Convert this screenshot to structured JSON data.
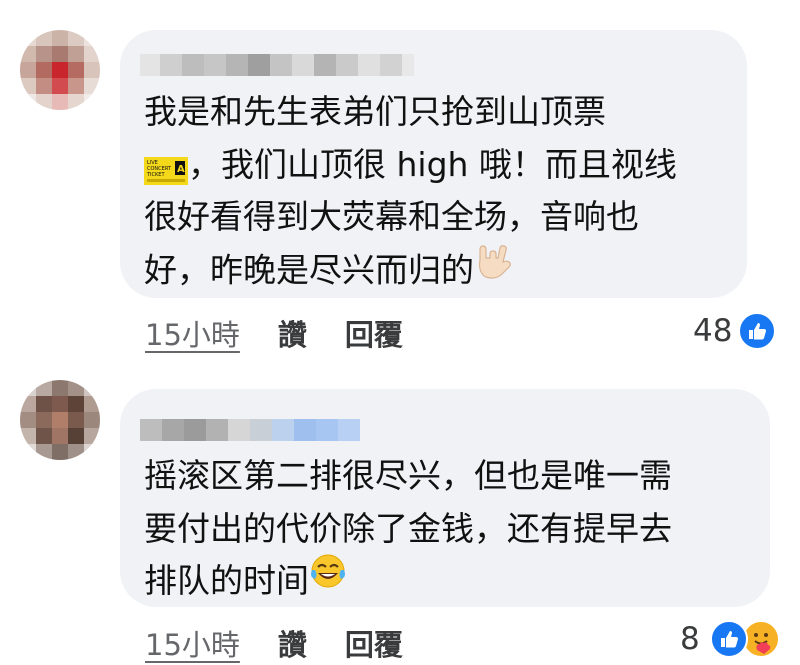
{
  "comments": [
    {
      "lines": [
        {
          "text": "我是和先生表弟们只抢到山顶票"
        },
        {
          "text": "，我们山顶很 high 哦！而且视线",
          "prefix_icon": "ticket-icon"
        },
        {
          "text": "很好看得到大荧幕和全场，音响也"
        },
        {
          "text": "好，昨晚是尽兴而归的",
          "suffix_icon": "love-you-gesture-emoji-icon"
        }
      ],
      "ticket_icon_text": [
        "LIVE",
        "CONCERT",
        "TICKET",
        "A"
      ],
      "time": "15小時",
      "like_label": "讚",
      "reply_label": "回覆",
      "reaction_count": "48",
      "reactions": [
        "like-reaction-icon"
      ]
    },
    {
      "lines": [
        {
          "text": "摇滚区第二排很尽兴，但也是唯一需"
        },
        {
          "text": "要付出的代价除了金钱，还有提早去"
        },
        {
          "text": "排队的时间",
          "suffix_icon": "tears-of-joy-emoji-icon"
        }
      ],
      "time": "15小時",
      "like_label": "讚",
      "reply_label": "回覆",
      "reaction_count": "8",
      "reactions": [
        "like-reaction-icon",
        "care-reaction-icon"
      ]
    }
  ],
  "colors": {
    "bubble": "#f0f2f5",
    "meta_text": "#65676b",
    "like_blue": "#1877f2",
    "care_yellow": "#f7b125"
  }
}
